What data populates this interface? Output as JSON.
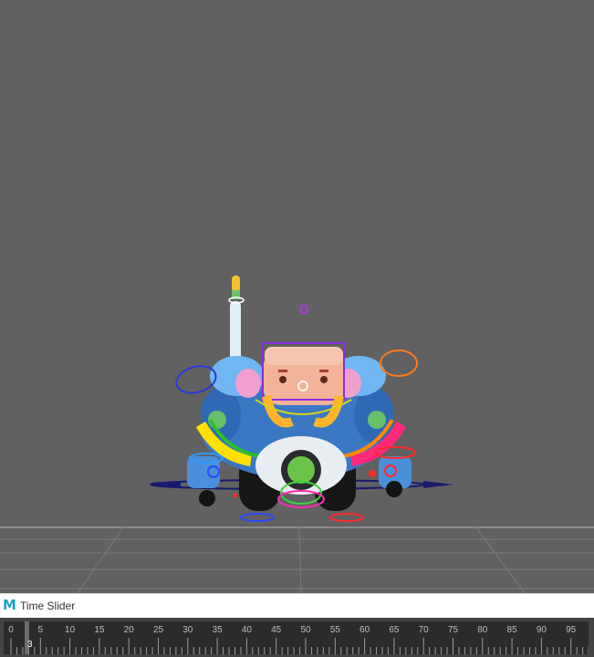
{
  "window": {
    "title": "Time Slider",
    "app_icon": "maya-logo-icon",
    "app_letter": "M"
  },
  "viewport": {
    "background": "#616161",
    "grid_color": "#7a7a7a"
  },
  "timeline": {
    "labels": [
      "0",
      "5",
      "10",
      "15",
      "20",
      "25",
      "30",
      "35",
      "40",
      "45",
      "50",
      "55",
      "60",
      "65",
      "70",
      "75",
      "80",
      "85",
      "90",
      "95"
    ],
    "current_frame": "3"
  }
}
